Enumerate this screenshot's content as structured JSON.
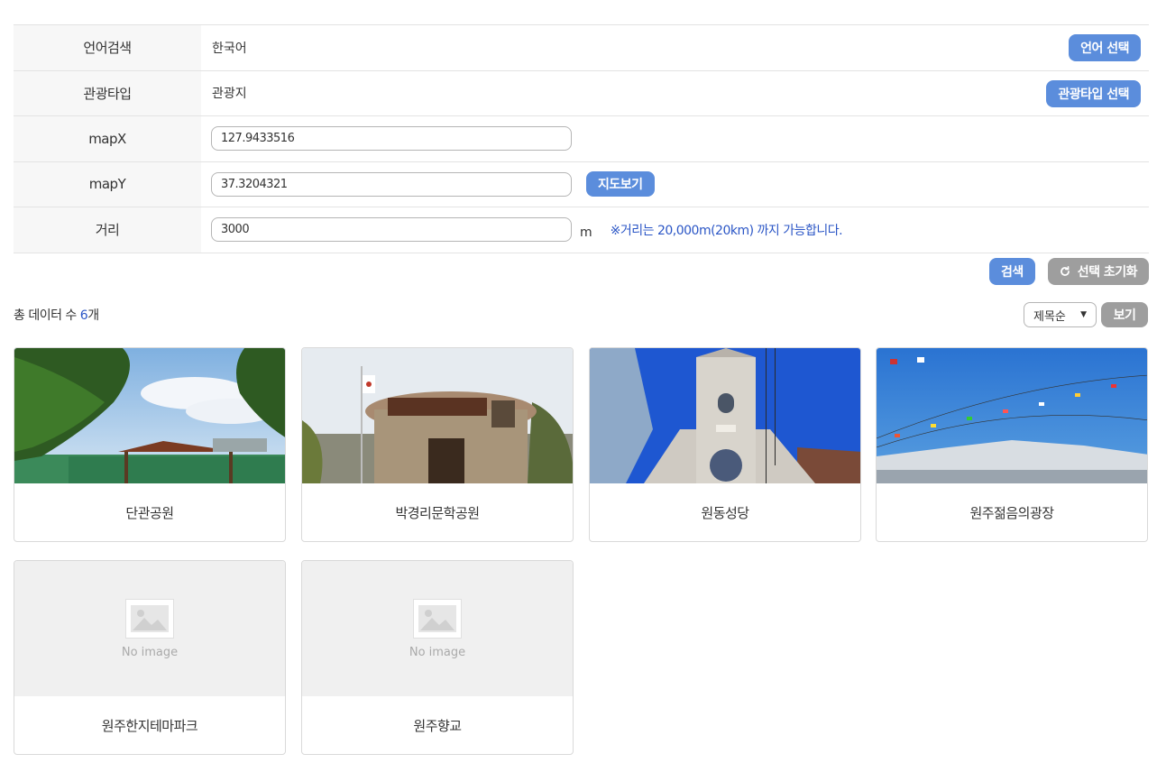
{
  "form": {
    "language": {
      "label": "언어검색",
      "value": "한국어",
      "button": "언어 선택"
    },
    "tour_type": {
      "label": "관광타입",
      "value": "관광지",
      "button": "관광타입 선택"
    },
    "map_x": {
      "label": "mapX",
      "value": "127.9433516"
    },
    "map_y": {
      "label": "mapY",
      "value": "37.3204321",
      "button": "지도보기"
    },
    "distance": {
      "label": "거리",
      "value": "3000",
      "unit": "m",
      "note": "※거리는 20,000m(20km) 까지 가능합니다."
    }
  },
  "actions": {
    "search": "검색",
    "reset": "선택 초기화"
  },
  "results": {
    "total_prefix": "총 데이터 수 ",
    "total_count": "6",
    "total_suffix": "개",
    "sort_selected": "제목순",
    "view_button": "보기"
  },
  "cards": [
    {
      "title": "단관공원",
      "image": "park-photo"
    },
    {
      "title": "박경리문학공원",
      "image": "literature-park-photo"
    },
    {
      "title": "원동성당",
      "image": "cathedral-photo"
    },
    {
      "title": "원주젊음의광장",
      "image": "plaza-photo"
    },
    {
      "title": "원주한지테마파크",
      "image": "none",
      "placeholder": "No image"
    },
    {
      "title": "원주향교",
      "image": "none",
      "placeholder": "No image"
    }
  ],
  "colors": {
    "accent": "#5b8ddc",
    "gray_button": "#9e9e9e",
    "link_blue": "#2b56c6"
  }
}
